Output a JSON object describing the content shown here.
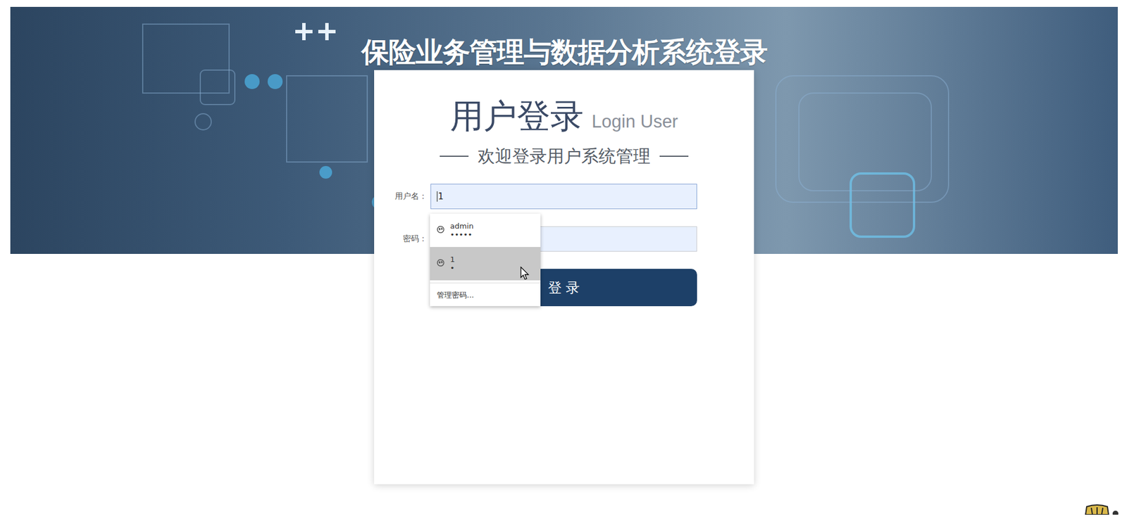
{
  "page": {
    "title": "保险业务管理与数据分析系统登录"
  },
  "login": {
    "heading": "用户登录",
    "subheading": "Login User",
    "welcome": "欢迎登录用户系统管理",
    "fields": [
      {
        "label": "用户名：",
        "value": "1",
        "focused": true
      },
      {
        "label": "密码：",
        "value": "",
        "focused": false
      }
    ],
    "button": "登 录"
  },
  "autocomplete": {
    "items": [
      {
        "user": "admin",
        "password": "•••••",
        "selected": false
      },
      {
        "user": "1",
        "password": "•",
        "selected": true
      }
    ],
    "manage": "管理密码..."
  }
}
